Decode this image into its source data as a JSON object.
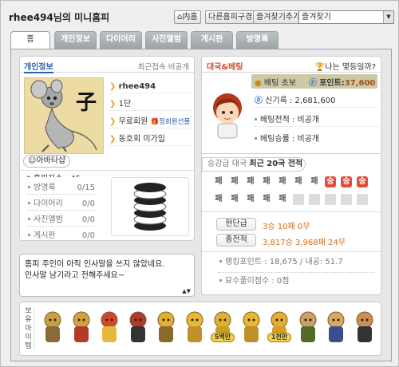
{
  "header": {
    "title": "rhee494님의 미니홈피",
    "btn_inbox": "内홈",
    "btn_diff": "다른홈피구경",
    "btn_fav": "즐겨찾기추가",
    "fav_select": "즐겨찾기"
  },
  "tabs": [
    "홈",
    "개인정보",
    "다이어리",
    "사진앨범",
    "게시판",
    "방명록"
  ],
  "profile": {
    "section": "개인정보",
    "recent": "최근접속 비공개",
    "char": "子",
    "username": "rhee494",
    "grade": "1단",
    "member": "무료회원",
    "member_badge": "정회원선물",
    "club": "동호회 미가입",
    "avatar_label": "아바타샵"
  },
  "stats": {
    "index_label": "홈피지수 : 45",
    "rows": [
      {
        "label": "방명록",
        "value": "0/15"
      },
      {
        "label": "다이어리",
        "value": "0/0"
      },
      {
        "label": "사진앨범",
        "value": "0/0"
      },
      {
        "label": "게시판",
        "value": "0/0"
      }
    ]
  },
  "greeting": "홈피 주인이 아직 인사말을 쓰지 않았네요.\n인사말 남기라고 전해주세요~",
  "betting": {
    "title": "대국&베팅",
    "how": "나는 몇등일까?",
    "badge": "베팅 초보",
    "points_label": "포인트:",
    "points": "37,600",
    "new_record_label": "신기록 :",
    "new_record": "2,681,600",
    "bet_record": "베팅전적 : 비공개",
    "bet_rate": "베팅승률 : 비공개"
  },
  "games": {
    "title_prefix": "승강급 대국",
    "title_bold": "최근 20국 전적",
    "row1": [
      "패",
      "패",
      "패",
      "패",
      "패",
      "패",
      "패",
      "승",
      "승",
      "승"
    ],
    "row2": [
      "패",
      "패",
      "패",
      "패",
      "패",
      "",
      "",
      "",
      "",
      ""
    ],
    "level_label": "현단급",
    "level_value": "3승 10패 0무",
    "total_label": "종전적",
    "total_value": "3,817승 3,968패 24무",
    "ranking": "랭킹포인트 : 18,675 / 내공: 51.7",
    "puzzle": "묘수풀이점수 : 0점"
  },
  "items": {
    "label": "보유아이템",
    "item_labels": [
      "5백만",
      "1천만"
    ]
  }
}
